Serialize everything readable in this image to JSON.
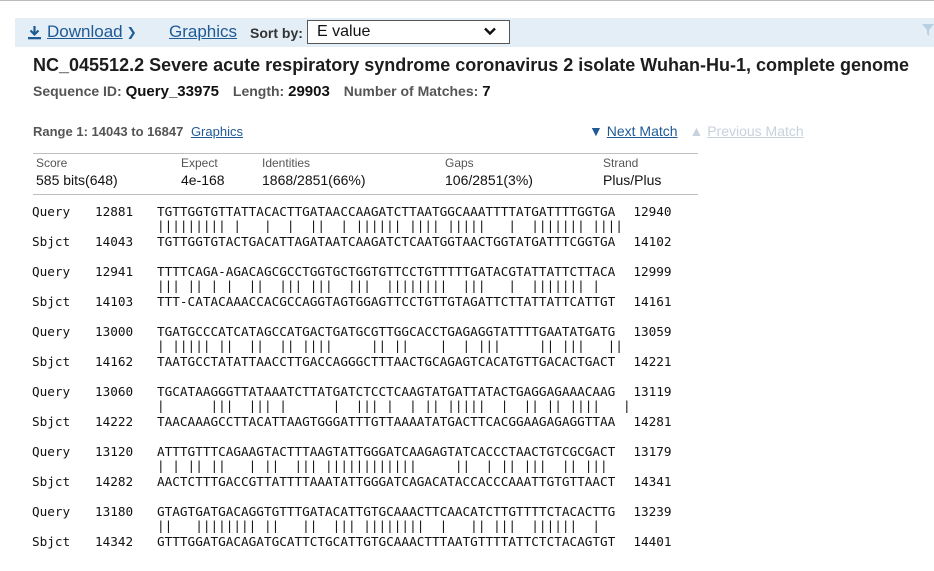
{
  "toolbar": {
    "download_label": "Download",
    "graphics_label": "Graphics",
    "sortby_label": "Sort by:",
    "sort_value": "E value",
    "filter_icon": "filter-icon"
  },
  "hit": {
    "title": "NC_045512.2 Severe acute respiratory syndrome coronavirus 2 isolate Wuhan-Hu-1, complete genome",
    "seqid_label": "Sequence ID:",
    "seqid": "Query_33975",
    "length_label": "Length:",
    "length": "29903",
    "matches_label": "Number of Matches:",
    "matches": "7"
  },
  "range": {
    "label": "Range 1: 14043 to 16847",
    "graphics_link": "Graphics",
    "next": "Next Match",
    "prev": "Previous Match"
  },
  "stats": [
    {
      "header": "Score",
      "value": "585 bits(648)"
    },
    {
      "header": "Expect",
      "value": "4e-168"
    },
    {
      "header": "Identities",
      "value": "1868/2851(66%)"
    },
    {
      "header": "Gaps",
      "value": "106/2851(3%)"
    },
    {
      "header": "Strand",
      "value": "Plus/Plus"
    }
  ],
  "alignment": [
    {
      "qname": "Query",
      "qstart": "12881",
      "qseq": "TGTTGGTGTTATTACACTTGATAACCAAGATCTTAATGGCAAATTTTATGATTTTGGTGA",
      "qend": "12940",
      "match": "||||||||| |   |  |  ||  | |||||| |||| |||||   |  ||||||| ||||",
      "sname": "Sbjct",
      "sstart": "14043",
      "sseq": "TGTTGGTGTACTGACATTAGATAATCAAGATCTCAATGGTAACTGGTATGATTTCGGTGA",
      "send": "14102"
    },
    {
      "qname": "Query",
      "qstart": "12941",
      "qseq": "TTTTCAGA-AGACAGCGCCTGGTGCTGGTGTTCCTGTTTTTGATACGTATTATTCTTACA",
      "qend": "12999",
      "match": "||| || | |  ||  ||| |||  |||  ||||||||  |||   |  ||||||| |  ",
      "sname": "Sbjct",
      "sstart": "14103",
      "sseq": "TTT-CATACAAACCACGCCAGGTAGTGGAGTTCCTGTTGTAGATTCTTATTATTCATTGT",
      "send": "14161"
    },
    {
      "qname": "Query",
      "qstart": "13000",
      "qseq": "TGATGCCCATCATAGCCATGACTGATGCGTTGGCACCTGAGAGGTATTTTGAATATGATG",
      "qend": "13059",
      "match": "| ||||| ||  ||  || ||||     || ||    |  | |||     || |||   ||",
      "sname": "Sbjct",
      "sstart": "14162",
      "sseq": "TAATGCCTATATTAACCTTGACCAGGGCTTTAACTGCAGAGTCACATGTTGACACTGACT",
      "send": "14221"
    },
    {
      "qname": "Query",
      "qstart": "13060",
      "qseq": "TGCATAAGGGTTATAAATCTTATGATCTCCTCAAGTATGATTATACTGAGGAGAAACAAG",
      "qend": "13119",
      "match": "|      |||  ||| |      |  ||| |  | || |||||  |  || || ||||   |",
      "sname": "Sbjct",
      "sstart": "14222",
      "sseq": "TAACAAAGCCTTACATTAAGTGGGATTTGTTAAAATATGACTTCACGGAAGAGAGGTTAA",
      "send": "14281"
    },
    {
      "qname": "Query",
      "qstart": "13120",
      "qseq": "ATTTGTTTCAGAAGTACTTTAAGTATTGGGATCAAGAGTATCACCCTAACTGTCGCGACT",
      "qend": "13179",
      "match": "| | || ||   | ||  ||| ||||||||||||     ||  | || |||  || |||",
      "sname": "Sbjct",
      "sstart": "14282",
      "sseq": "AACTCTTTGACCGTTATTTTAAATATTGGGATCAGACATACCACCCAAATTGTGTTAACT",
      "send": "14341"
    },
    {
      "qname": "Query",
      "qstart": "13180",
      "qseq": "GTAGTGATGACAGGTGTTTGATACATTGTGCAAACTTCAACATCTTGTTTTCTACACTTG",
      "qend": "13239",
      "match": "||   |||||||| ||   ||  ||| ||||||||  |   || |||  ||||||  |",
      "sname": "Sbjct",
      "sstart": "14342",
      "sseq": "GTTTGGATGACAGATGCATTCTGCATTGTGCAAACTTTAATGTTTTATTCTCTACAGTGT",
      "send": "14401"
    }
  ]
}
